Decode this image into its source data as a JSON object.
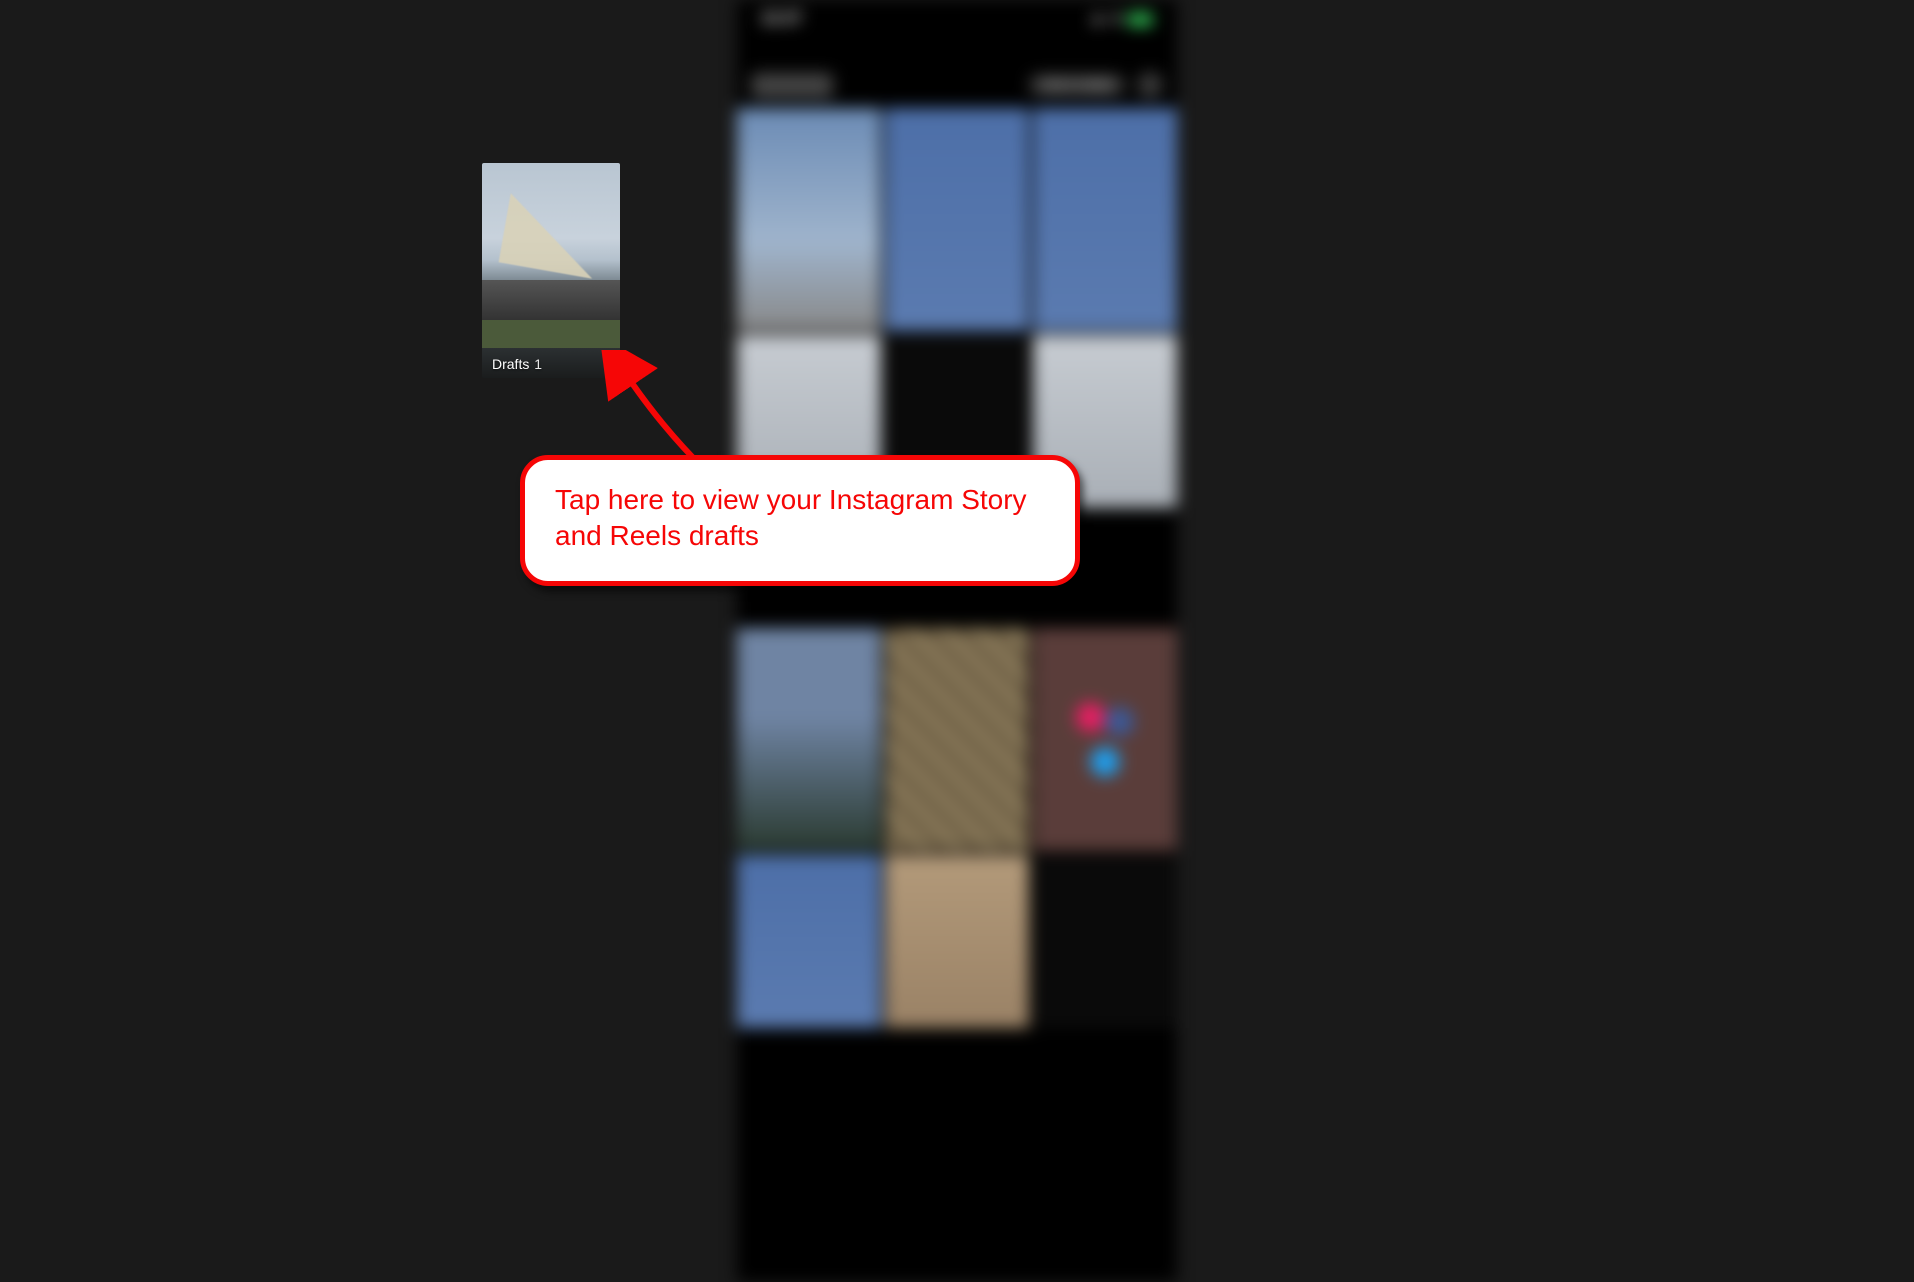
{
  "phone": {
    "status_time": "12:27",
    "header_title": "Reels",
    "header_pill": "Select multiple"
  },
  "drafts": {
    "label": "Drafts",
    "count": "1"
  },
  "callout": {
    "text": "Tap here to view your Instagram Story and Reels drafts"
  }
}
